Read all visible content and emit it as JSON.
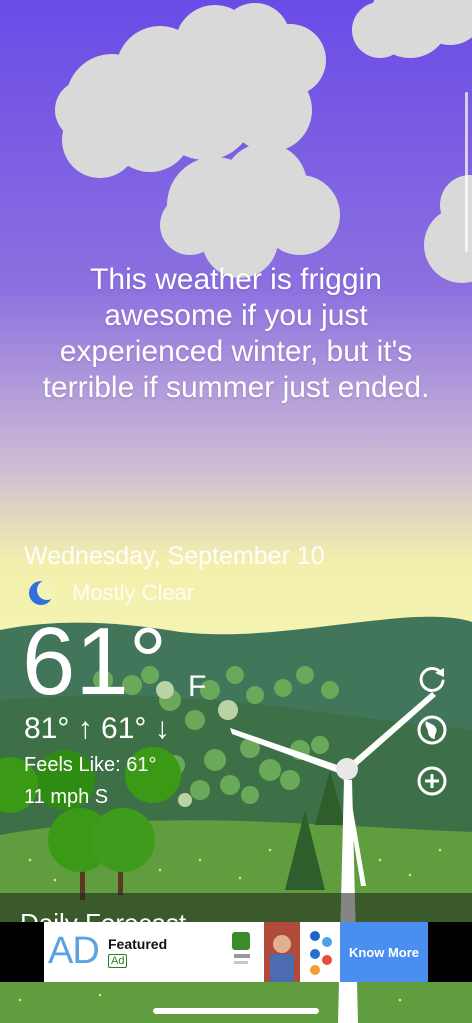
{
  "message": {
    "line1": "This weather is friggin",
    "line2": "awesome if you just",
    "line3": "experienced winter, but it's",
    "line4": "terrible if summer just ended."
  },
  "current": {
    "date": "Wednesday, September 10",
    "condition": "Mostly Clear",
    "condition_icon": "moon-icon",
    "temperature": "61°",
    "unit": "F",
    "hilo": "81° ↑ 61° ↓",
    "feels_like": "Feels Like: 61°",
    "wind": "11 mph S"
  },
  "actions": {
    "refresh_icon": "refresh-icon",
    "location_icon": "globe-icon",
    "add_icon": "add-icon"
  },
  "forecast": {
    "title": "Daily Forecast"
  },
  "ad": {
    "logo": "AD",
    "featured": "Featured",
    "badge": "Ad",
    "button": "Know More"
  },
  "colors": {
    "sky_top": "#6a4be6",
    "sky_bottom": "#f5f5b0",
    "hill_back": "#41765a",
    "hill_front": "#5f9d3e",
    "ad_button": "#4a8ff0"
  }
}
